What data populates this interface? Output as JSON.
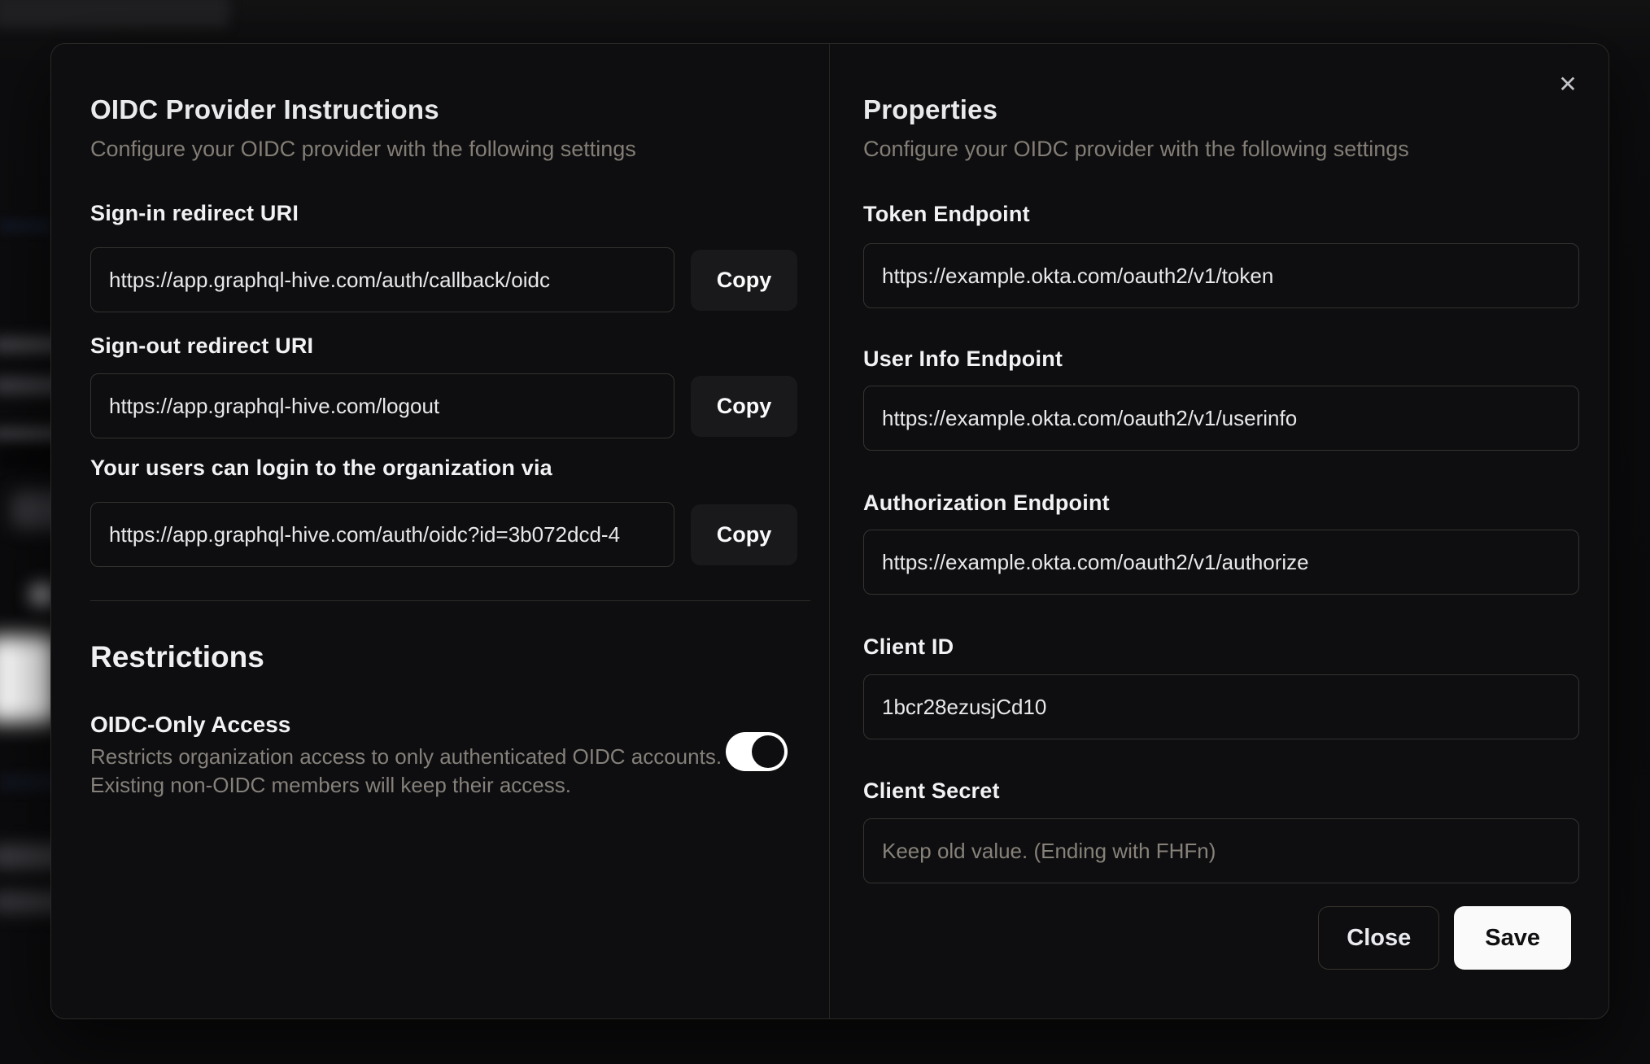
{
  "icons": {
    "close": "✕"
  },
  "colors": {
    "page_bg": "#0b0b0d",
    "modal_bg": "#0e0e10",
    "border": "#343330",
    "muted_text": "#837d75",
    "primary_text": "#eeeef0",
    "save_button_bg": "#fafafa",
    "toggle_on_track": "#ffffff"
  },
  "modal": {
    "instructions": {
      "title": "OIDC Provider Instructions",
      "subtitle": "Configure your OIDC provider with the following settings",
      "fields": [
        {
          "label": "Sign-in redirect URI",
          "value": "https://app.graphql-hive.com/auth/callback/oidc",
          "action": "Copy"
        },
        {
          "label": "Sign-out redirect URI",
          "value": "https://app.graphql-hive.com/logout",
          "action": "Copy"
        },
        {
          "label": "Your users can login to the organization via",
          "value": "https://app.graphql-hive.com/auth/oidc?id=3b072dcd-4",
          "action": "Copy"
        }
      ]
    },
    "restrictions": {
      "title": "Restrictions",
      "oidc_only": {
        "label": "OIDC-Only Access",
        "description_line1": "Restricts organization access to only authenticated OIDC accounts.",
        "description_line2": "Existing non-OIDC members will keep their access.",
        "enabled": true
      }
    },
    "properties": {
      "title": "Properties",
      "subtitle": "Configure your OIDC provider with the following settings",
      "fields": [
        {
          "label": "Token Endpoint",
          "value": "https://example.okta.com/oauth2/v1/token"
        },
        {
          "label": "User Info Endpoint",
          "value": "https://example.okta.com/oauth2/v1/userinfo"
        },
        {
          "label": "Authorization Endpoint",
          "value": "https://example.okta.com/oauth2/v1/authorize"
        },
        {
          "label": "Client ID",
          "value": "1bcr28ezusjCd10"
        },
        {
          "label": "Client Secret",
          "value": "",
          "placeholder": "Keep old value. (Ending with FHFn)"
        }
      ],
      "actions": {
        "close": "Close",
        "save": "Save"
      }
    }
  }
}
